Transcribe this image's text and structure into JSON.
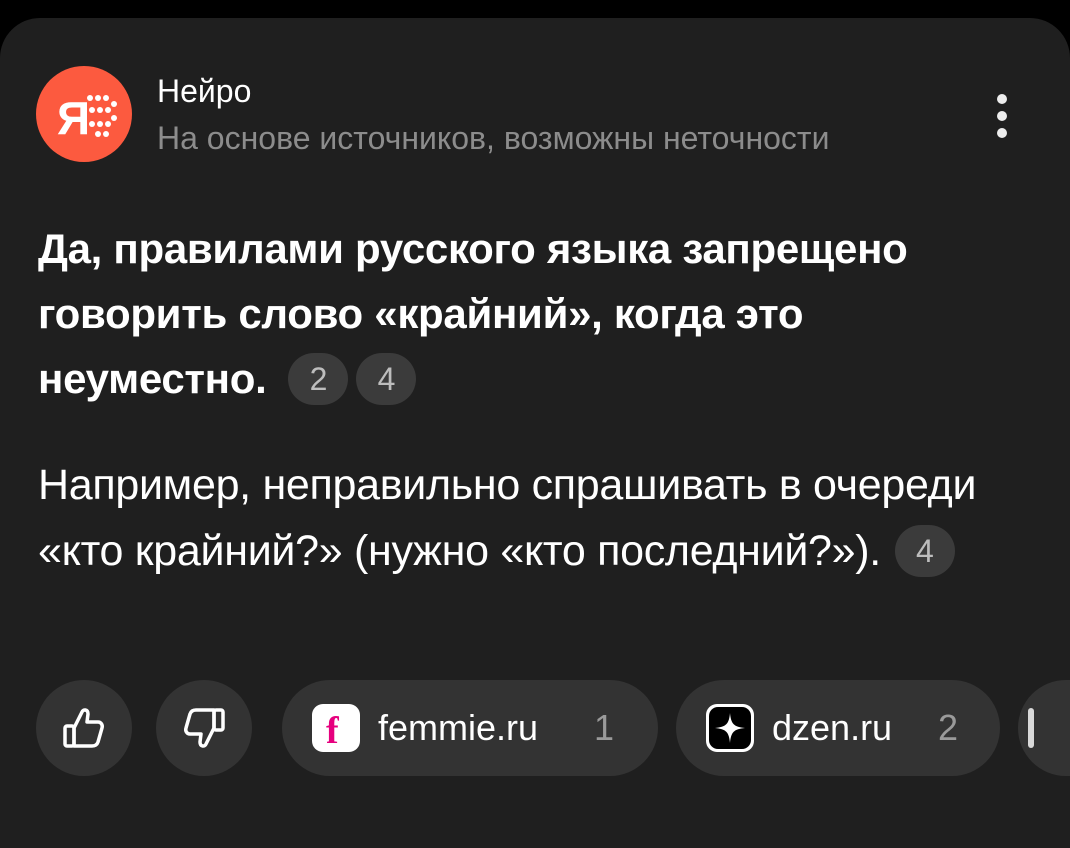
{
  "header": {
    "title": "Нейро",
    "subtitle": "На основе источников, возможны неточности",
    "avatar_color": "#fc5a3f",
    "avatar_icon": "yandex-ya-dots-logo",
    "more_icon": "vertical-dots-icon"
  },
  "answer": {
    "main": "Да, правилами русского языка запрещено говорить слово «крайний», когда это неуместно.",
    "main_citations": [
      "2",
      "4"
    ],
    "detail": "Например, неправильно спрашивать в очереди «кто крайний?» (нужно «кто последний?»).",
    "detail_citations": [
      "4"
    ]
  },
  "feedback": {
    "like_icon": "thumbs-up-icon",
    "dislike_icon": "thumbs-down-icon"
  },
  "sources": [
    {
      "name": "femmie.ru",
      "count": "1",
      "icon": "femmie-f-icon"
    },
    {
      "name": "dzen.ru",
      "count": "2",
      "icon": "dzen-star-icon"
    }
  ],
  "colors": {
    "background": "#000000",
    "card": "#1f1f1f",
    "chip": "#333333",
    "citation": "#3b3b3b",
    "muted_text": "#8c8c8c",
    "femmie_brand": "#e6007e"
  }
}
